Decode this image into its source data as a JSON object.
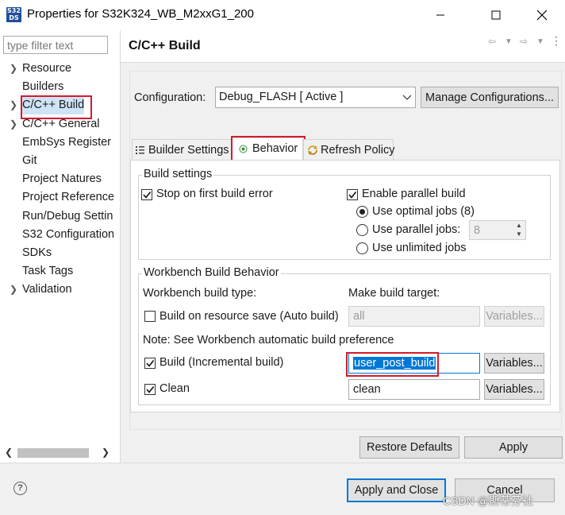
{
  "window": {
    "title": "Properties for S32K324_WB_M2xxG1_200",
    "icon_text": "S32 DS"
  },
  "sidebar": {
    "filter_placeholder": "type filter text",
    "items": [
      {
        "label": "Resource",
        "expandable": true
      },
      {
        "label": "Builders",
        "expandable": false
      },
      {
        "label": "C/C++ Build",
        "expandable": true,
        "selected": true
      },
      {
        "label": "C/C++ General",
        "expandable": true
      },
      {
        "label": "EmbSys Register V",
        "expandable": false
      },
      {
        "label": "Git",
        "expandable": false
      },
      {
        "label": "Project Natures",
        "expandable": false
      },
      {
        "label": "Project References",
        "expandable": false
      },
      {
        "label": "Run/Debug Settings",
        "expandable": false
      },
      {
        "label": "S32 Configuration",
        "expandable": false
      },
      {
        "label": "SDKs",
        "expandable": false
      },
      {
        "label": "Task Tags",
        "expandable": false
      },
      {
        "label": "Validation",
        "expandable": true
      }
    ]
  },
  "page": {
    "title": "C/C++ Build",
    "configuration_label": "Configuration:",
    "configuration_value": "Debug_FLASH  [ Active ]",
    "manage_button": "Manage Configurations...",
    "tabs": [
      {
        "label": "Builder Settings",
        "icon": "list-icon"
      },
      {
        "label": "Behavior",
        "icon": "radio-dot-icon",
        "active": true
      },
      {
        "label": "Refresh Policy",
        "icon": "refresh-icon"
      }
    ],
    "build_settings": {
      "title": "Build settings",
      "stop_on_error": {
        "label": "Stop on first build error",
        "checked": true
      },
      "enable_parallel": {
        "label": "Enable parallel build",
        "checked": true
      },
      "optimal_jobs": {
        "label": "Use optimal jobs (8)",
        "selected": true
      },
      "parallel_jobs": {
        "label": "Use parallel jobs:",
        "selected": false,
        "value": "8"
      },
      "unlimited_jobs": {
        "label": "Use unlimited jobs",
        "selected": false
      }
    },
    "workbench": {
      "title": "Workbench Build Behavior",
      "build_type_header": "Workbench build type:",
      "make_target_header": "Make build target:",
      "auto_build": {
        "label": "Build on resource save (Auto build)",
        "checked": false,
        "target": "all"
      },
      "note": "Note: See Workbench automatic build preference",
      "incremental": {
        "label": "Build (Incremental build)",
        "checked": true,
        "target": "user_post_build"
      },
      "clean": {
        "label": "Clean",
        "checked": true,
        "target": "clean"
      },
      "variables_button": "Variables..."
    },
    "restore_defaults": "Restore Defaults",
    "apply": "Apply"
  },
  "footer": {
    "apply_close": "Apply and Close",
    "cancel": "Cancel"
  },
  "watermark": "CSDN @斯蒂芬社",
  "colors": {
    "highlight_red": "#d41b2c",
    "selection_blue": "#0078d7",
    "tree_selected": "#cfe3f7"
  }
}
